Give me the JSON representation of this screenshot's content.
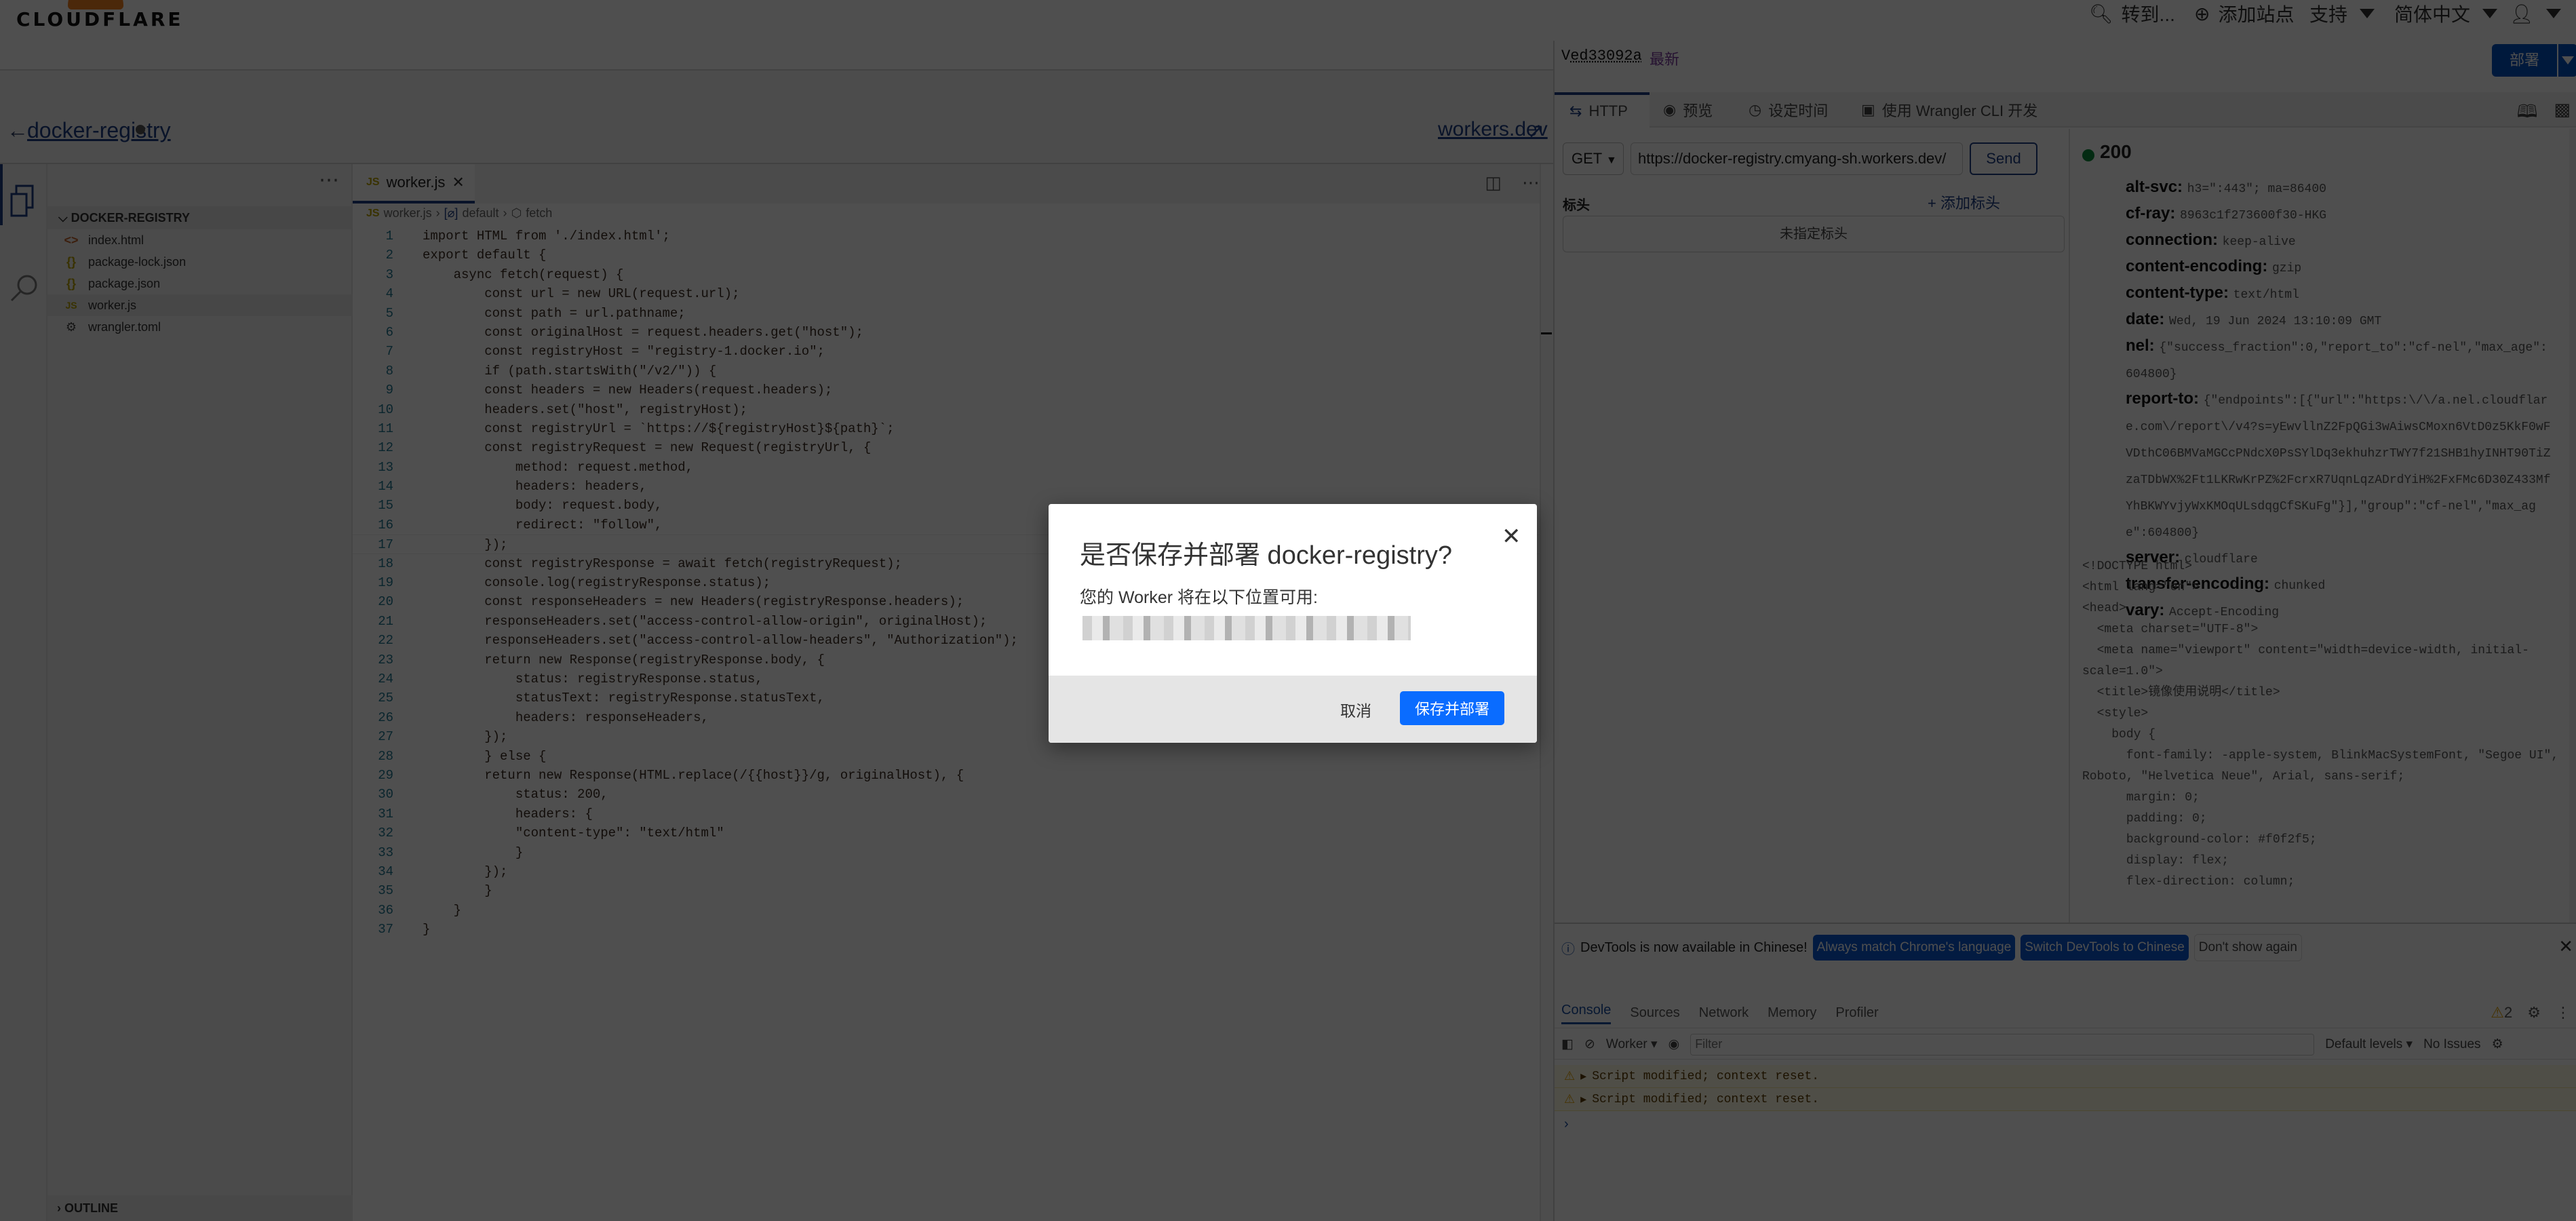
{
  "topbar": {
    "logo_text": "CLOUDFLARE",
    "goto_label": "转到...",
    "add_site_label": "添加站点",
    "support_label": "支持",
    "language_label": "简体中文"
  },
  "subbar": {
    "worker_name": "docker-registry",
    "workers_link": "workers.dev"
  },
  "explorer": {
    "root": "DOCKER-REGISTRY",
    "files": [
      {
        "name": "index.html",
        "icon": "<>"
      },
      {
        "name": "package-lock.json",
        "icon": "{}"
      },
      {
        "name": "package.json",
        "icon": "{}"
      },
      {
        "name": "worker.js",
        "icon": "JS"
      },
      {
        "name": "wrangler.toml",
        "icon": "⚙"
      }
    ],
    "outline_label": "OUTLINE"
  },
  "editor": {
    "tab_label": "worker.js",
    "breadcrumb": [
      "worker.js",
      "default",
      "fetch"
    ],
    "lines": [
      "import HTML from './index.html';",
      "export default {",
      "    async fetch(request) {",
      "        const url = new URL(request.url);",
      "        const path = url.pathname;",
      "        const originalHost = request.headers.get(\"host\");",
      "        const registryHost = \"registry-1.docker.io\";",
      "        if (path.startsWith(\"/v2/\")) {",
      "        const headers = new Headers(request.headers);",
      "        headers.set(\"host\", registryHost);",
      "        const registryUrl = `https://${registryHost}${path}`;",
      "        const registryRequest = new Request(registryUrl, {",
      "            method: request.method,",
      "            headers: headers,",
      "            body: request.body,",
      "            redirect: \"follow\",",
      "        });",
      "        const registryResponse = await fetch(registryRequest);",
      "        console.log(registryResponse.status);",
      "        const responseHeaders = new Headers(registryResponse.headers);",
      "        responseHeaders.set(\"access-control-allow-origin\", originalHost);",
      "        responseHeaders.set(\"access-control-allow-headers\", \"Authorization\");",
      "        return new Response(registryResponse.body, {",
      "            status: registryResponse.status,",
      "            statusText: registryResponse.statusText,",
      "            headers: responseHeaders,",
      "        });",
      "        } else {",
      "        return new Response(HTML.replace(/{{host}}/g, originalHost), {",
      "            status: 200,",
      "            headers: {",
      "            \"content-type\": \"text/html\"",
      "            }",
      "        });",
      "        }",
      "    }",
      "}"
    ]
  },
  "right_panel": {
    "version_prefix": "V",
    "version_hash": "ed33092a",
    "version_badge": "最新",
    "deploy_label": "部署",
    "tabs": [
      "HTTP",
      "预览",
      "设定时间",
      "使用 Wrangler CLI 开发"
    ],
    "request": {
      "method": "GET",
      "url": "https://docker-registry.cmyang-sh.workers.dev/",
      "send_label": "Send",
      "headers_label": "标头",
      "add_header_label": "添加标头",
      "no_headers_text": "未指定标头"
    },
    "response": {
      "status": "200",
      "headers": [
        {
          "key": "alt-svc:",
          "value": "h3=\":443\"; ma=86400"
        },
        {
          "key": "cf-ray:",
          "value": "8963c1f273600f30-HKG"
        },
        {
          "key": "connection:",
          "value": "keep-alive"
        },
        {
          "key": "content-encoding:",
          "value": "gzip"
        },
        {
          "key": "content-type:",
          "value": "text/html"
        },
        {
          "key": "date:",
          "value": "Wed, 19 Jun 2024 13:10:09 GMT"
        },
        {
          "key": "nel:",
          "value": "{\"success_fraction\":0,\"report_to\":\"cf-nel\",\"max_age\":604800}"
        },
        {
          "key": "report-to:",
          "value": "{\"endpoints\":[{\"url\":\"https:\\/\\/a.nel.cloudflare.com\\/report\\/v4?s=yEwvllnZ2FpQGi3wAiwsCMoxn6VtD0z5KkF0wFVDthC06BMVaMGCcPNdcX0PsSYlDq3ekhuhzrTWY7f21SHB1hyINHT90TiZzaTDbWX%2Ft1LKRwKrPZ%2FcrxR7UqnLqzADrdYiH%2FxFMc6D30Z433MfYhBKWYvjyWxKMOqULsdqgCfSKuFg\"}],\"group\":\"cf-nel\",\"max_age\":604800}"
        },
        {
          "key": "server:",
          "value": "cloudflare"
        },
        {
          "key": "transfer-encoding:",
          "value": "chunked"
        },
        {
          "key": "vary:",
          "value": "Accept-Encoding"
        }
      ],
      "body": "<!DOCTYPE html>\n<html lang=\"en\">\n<head>\n  <meta charset=\"UTF-8\">\n  <meta name=\"viewport\" content=\"width=device-width, initial-scale=1.0\">\n  <title>镜像使用说明</title>\n  <style>\n    body {\n      font-family: -apple-system, BlinkMacSystemFont, \"Segoe UI\", Roboto, \"Helvetica Neue\", Arial, sans-serif;\n      margin: 0;\n      padding: 0;\n      background-color: #f0f2f5;\n      display: flex;\n      flex-direction: column;"
    }
  },
  "devtools": {
    "info_text": "DevTools is now available in Chinese!",
    "match_btn": "Always match Chrome's language",
    "switch_btn": "Switch DevTools to Chinese",
    "dont_show_btn": "Don't show again",
    "tabs": [
      "Console",
      "Sources",
      "Network",
      "Memory",
      "Profiler"
    ],
    "warning_count": "2",
    "context": "Worker",
    "filter_placeholder": "Filter",
    "levels": "Default levels",
    "issues": "No Issues",
    "messages": [
      "Script modified; context reset.",
      "Script modified; context reset."
    ]
  },
  "modal": {
    "title": "是否保存并部署 docker-registry?",
    "body": "您的 Worker 将在以下位置可用:",
    "cancel_label": "取消",
    "confirm_label": "保存并部署"
  },
  "colors": {
    "brand": "#f38020",
    "primary_button": "#0a6cff",
    "deploy_button": "#0051c3",
    "status_ok": "#0a8a3a"
  }
}
